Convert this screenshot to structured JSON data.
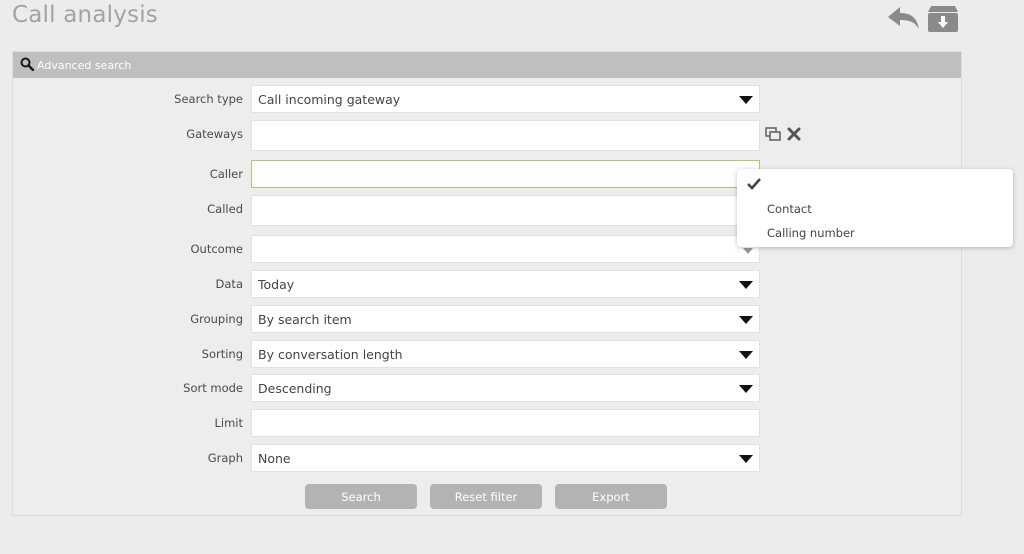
{
  "page": {
    "title": "Call analysis"
  },
  "toolbar": {
    "back_icon": "back-arrow-icon",
    "archive_icon": "archive-download-icon"
  },
  "panel": {
    "header_label": "Advanced search",
    "header_icon": "search-icon"
  },
  "form": {
    "search_type": {
      "label": "Search type",
      "value": "Call incoming gateway"
    },
    "gateways": {
      "label": "Gateways",
      "value": ""
    },
    "caller": {
      "label": "Caller",
      "value": ""
    },
    "called": {
      "label": "Called",
      "value": ""
    },
    "outcome": {
      "label": "Outcome",
      "value": ""
    },
    "data": {
      "label": "Data",
      "value": "Today"
    },
    "grouping": {
      "label": "Grouping",
      "value": "By search item"
    },
    "sorting": {
      "label": "Sorting",
      "value": "By conversation length"
    },
    "sort_mode": {
      "label": "Sort mode",
      "value": "Descending"
    },
    "limit": {
      "label": "Limit",
      "value": ""
    },
    "graph": {
      "label": "Graph",
      "value": "None"
    }
  },
  "caller_dropdown": {
    "options": [
      "Contact",
      "Calling number"
    ]
  },
  "buttons": {
    "search": "Search",
    "reset": "Reset filter",
    "export": "Export"
  }
}
